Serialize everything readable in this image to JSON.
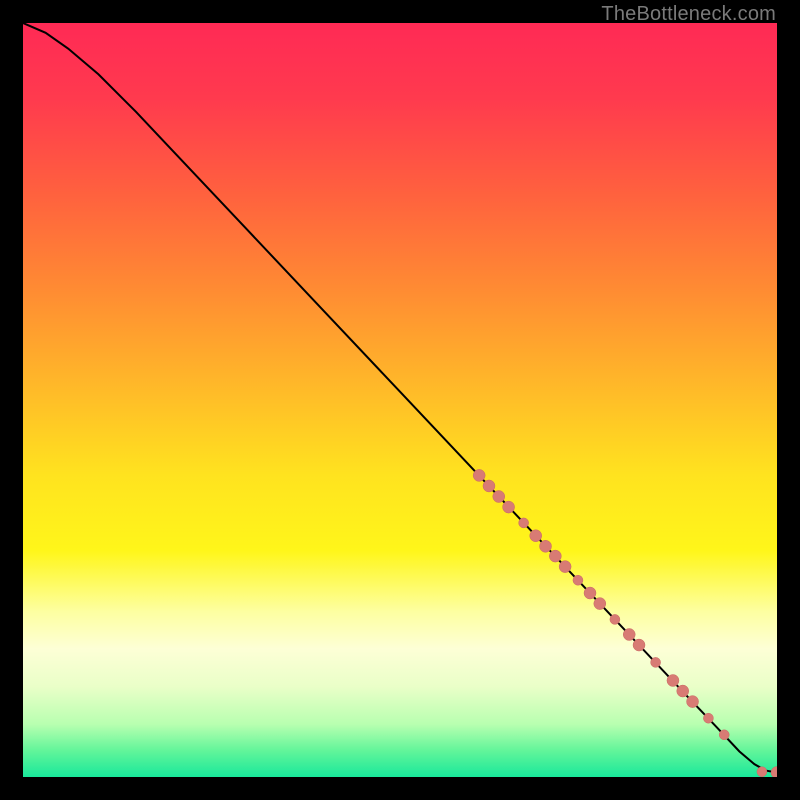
{
  "watermark": "TheBottleneck.com",
  "colors": {
    "gradient_stops": [
      {
        "offset": 0.0,
        "color": "#ff2a55"
      },
      {
        "offset": 0.1,
        "color": "#ff3a4e"
      },
      {
        "offset": 0.22,
        "color": "#ff5f3f"
      },
      {
        "offset": 0.35,
        "color": "#ff8a33"
      },
      {
        "offset": 0.48,
        "color": "#ffb829"
      },
      {
        "offset": 0.6,
        "color": "#ffe31f"
      },
      {
        "offset": 0.7,
        "color": "#fff61a"
      },
      {
        "offset": 0.78,
        "color": "#fdffa0"
      },
      {
        "offset": 0.83,
        "color": "#fdffd6"
      },
      {
        "offset": 0.88,
        "color": "#eaffc8"
      },
      {
        "offset": 0.93,
        "color": "#b8ffb0"
      },
      {
        "offset": 0.965,
        "color": "#62f59a"
      },
      {
        "offset": 1.0,
        "color": "#19e89b"
      }
    ],
    "curve": "#000000",
    "marker_fill": "#d87b74",
    "marker_stroke": "#c96a63"
  },
  "chart_data": {
    "type": "line",
    "title": "",
    "xlabel": "",
    "ylabel": "",
    "xlim": [
      0,
      100
    ],
    "ylim": [
      0,
      100
    ],
    "series": [
      {
        "name": "curve",
        "x": [
          0,
          3,
          6,
          10,
          15,
          20,
          30,
          40,
          50,
          60,
          70,
          80,
          88,
          92,
          95,
          97,
          98.5,
          100
        ],
        "y": [
          100,
          98.7,
          96.6,
          93.2,
          88.2,
          82.9,
          72.3,
          61.7,
          51.1,
          40.5,
          29.9,
          19.3,
          10.8,
          6.6,
          3.4,
          1.7,
          0.85,
          0.6
        ]
      }
    ],
    "markers": [
      {
        "x": 60.5,
        "y": 40.0,
        "r": 6
      },
      {
        "x": 61.8,
        "y": 38.6,
        "r": 6
      },
      {
        "x": 63.1,
        "y": 37.2,
        "r": 6
      },
      {
        "x": 64.4,
        "y": 35.8,
        "r": 6
      },
      {
        "x": 66.4,
        "y": 33.7,
        "r": 5
      },
      {
        "x": 68.0,
        "y": 32.0,
        "r": 6
      },
      {
        "x": 69.3,
        "y": 30.6,
        "r": 6
      },
      {
        "x": 70.6,
        "y": 29.3,
        "r": 6
      },
      {
        "x": 71.9,
        "y": 27.9,
        "r": 6
      },
      {
        "x": 73.6,
        "y": 26.1,
        "r": 5
      },
      {
        "x": 75.2,
        "y": 24.4,
        "r": 6
      },
      {
        "x": 76.5,
        "y": 23.0,
        "r": 6
      },
      {
        "x": 78.5,
        "y": 20.9,
        "r": 5
      },
      {
        "x": 80.4,
        "y": 18.9,
        "r": 6
      },
      {
        "x": 81.7,
        "y": 17.5,
        "r": 6
      },
      {
        "x": 83.9,
        "y": 15.2,
        "r": 5
      },
      {
        "x": 86.2,
        "y": 12.8,
        "r": 6
      },
      {
        "x": 87.5,
        "y": 11.4,
        "r": 6
      },
      {
        "x": 88.8,
        "y": 10.0,
        "r": 6
      },
      {
        "x": 90.9,
        "y": 7.8,
        "r": 5
      },
      {
        "x": 93.0,
        "y": 5.6,
        "r": 5
      },
      {
        "x": 98.0,
        "y": 0.7,
        "r": 5
      },
      {
        "x": 100.0,
        "y": 0.6,
        "r": 6
      }
    ]
  }
}
